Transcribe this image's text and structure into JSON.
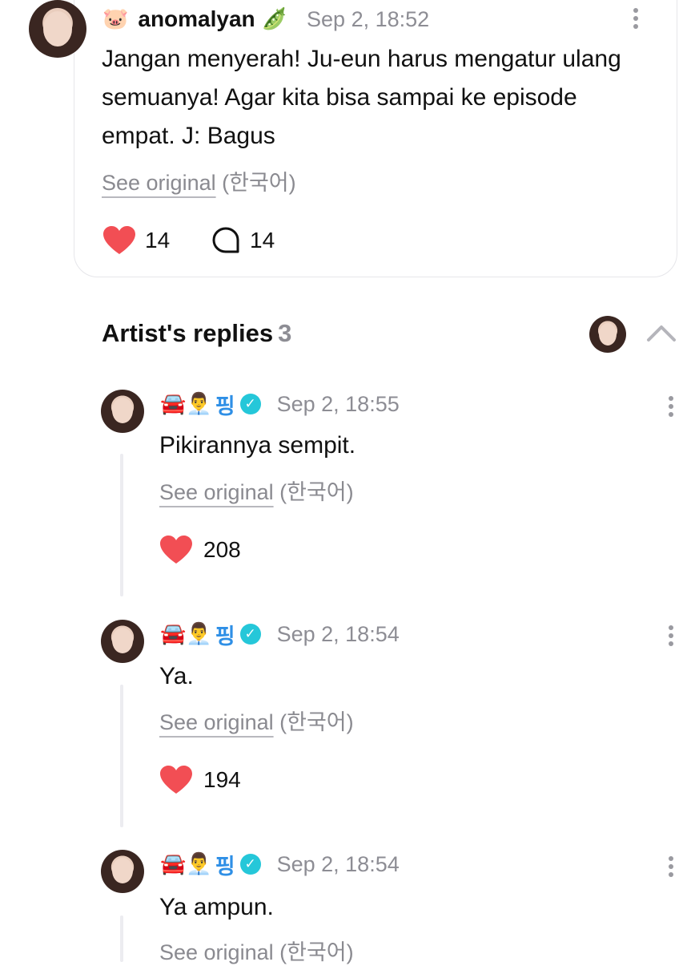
{
  "post": {
    "username_prefix_emoji": "🐷",
    "username": "anomalyan",
    "username_suffix_emoji": "🫛",
    "time": "Sep 2, 18:52",
    "text": "Jangan menyerah! Ju-eun harus mengatur ulang semuanya! Agar kita bisa sampai ke episode empat. J: Bagus",
    "see_original": "See original",
    "language": "(한국어)",
    "likes": "14",
    "comments": "14"
  },
  "replies_section": {
    "title": "Artist's replies",
    "count": "3"
  },
  "replies": [
    {
      "emoji": "🚘👨‍💼",
      "name": "핑",
      "time": "Sep 2, 18:55",
      "text": "Pikirannya sempit.",
      "see_original": "See original",
      "language": "(한국어)",
      "likes": "208"
    },
    {
      "emoji": "🚘👨‍💼",
      "name": "핑",
      "time": "Sep 2, 18:54",
      "text": "Ya.",
      "see_original": "See original",
      "language": "(한국어)",
      "likes": "194"
    },
    {
      "emoji": "🚘👨‍💼",
      "name": "핑",
      "time": "Sep 2, 18:54",
      "text": "Ya ampun.",
      "see_original": "See original",
      "language": "(한국어)"
    }
  ],
  "colors": {
    "heart": "#f24e54",
    "muted": "#8d8d94",
    "verified": "#25c7d9",
    "artist_name": "#2e8fe6"
  },
  "icons": [
    "heart-icon",
    "comment-icon",
    "kebab-menu-icon",
    "chevron-up-icon",
    "verified-badge-icon"
  ]
}
